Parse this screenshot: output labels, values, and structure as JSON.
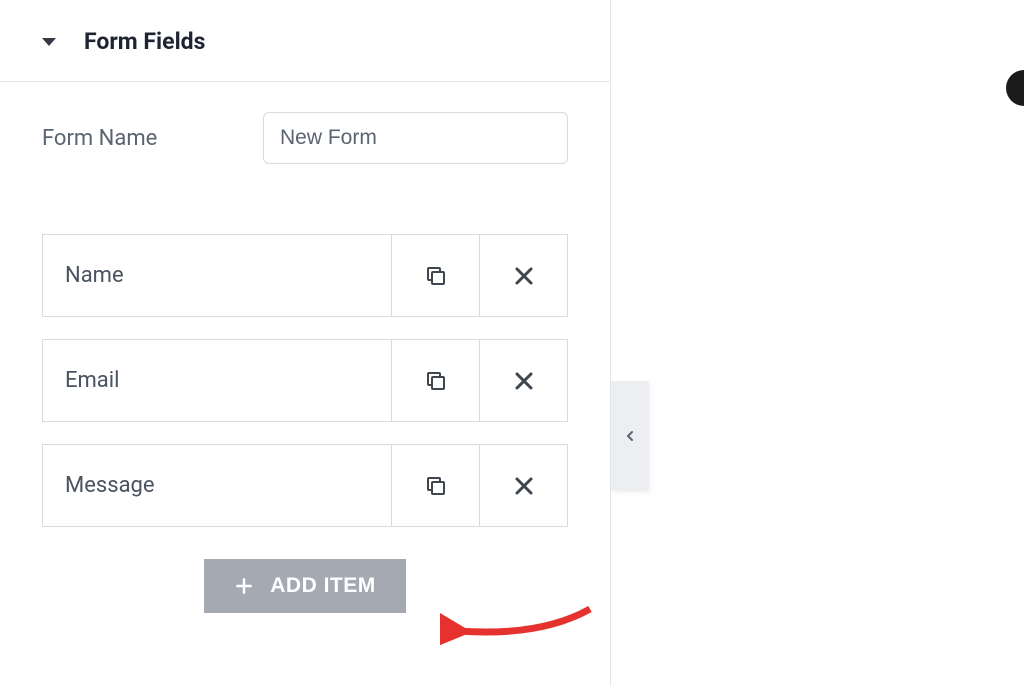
{
  "section": {
    "title": "Form Fields"
  },
  "form": {
    "name_label": "Form Name",
    "name_value": "New Form"
  },
  "fields": [
    {
      "label": "Name"
    },
    {
      "label": "Email"
    },
    {
      "label": "Message"
    }
  ],
  "buttons": {
    "add_item": "ADD ITEM"
  }
}
